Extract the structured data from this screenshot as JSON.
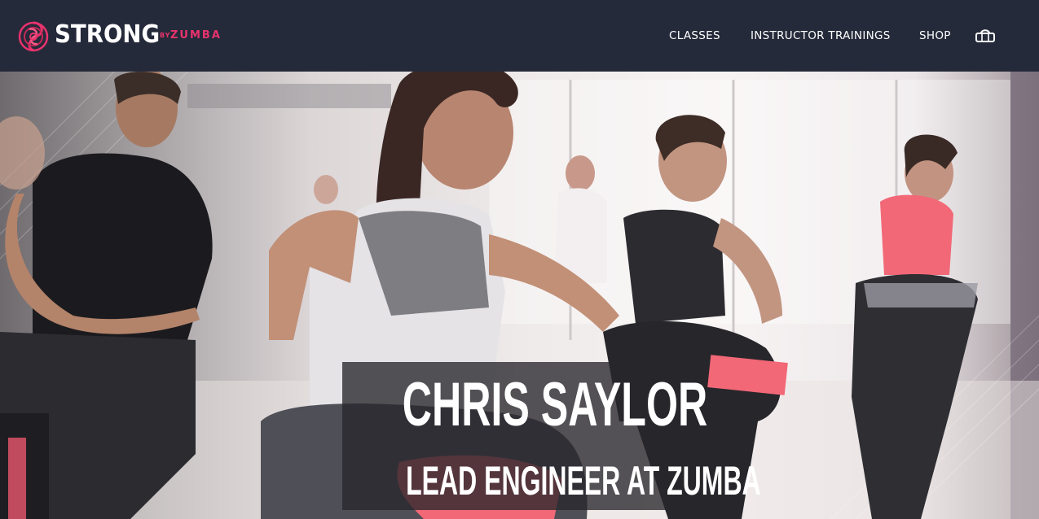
{
  "header": {
    "logo": {
      "brand": "STRONG",
      "by": "BY",
      "sub": "ZUMBA"
    },
    "nav": [
      {
        "label": "CLASSES"
      },
      {
        "label": "INSTRUCTOR TRAININGS"
      },
      {
        "label": "SHOP"
      }
    ],
    "cart_icon": "shopping-bag-icon"
  },
  "hero": {
    "image": "group-fitness-class-photo",
    "name": "CHRIS SAYLOR",
    "title": "LEAD ENGINEER AT ZUMBA"
  },
  "colors": {
    "header_bg": "#252a3a",
    "brand_pink": "#e8336d",
    "caption_bg": "#28262c",
    "text": "#ffffff"
  }
}
